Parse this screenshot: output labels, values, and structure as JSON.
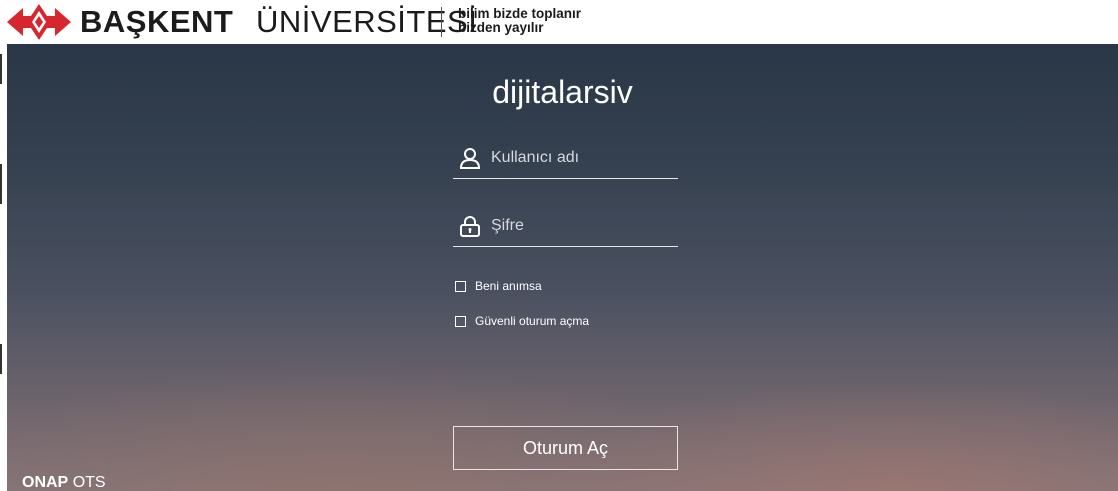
{
  "header": {
    "brand_bold": "BAŞKENT",
    "brand_thin": "ÜNİVERSİTESİ",
    "slogan_line1": "bilim bizde toplanır",
    "slogan_line2": "bizden yayılır",
    "logo_icon": "baskent-logo-icon",
    "logo_color": "#d7262e"
  },
  "login": {
    "title": "dijitalarsiv",
    "username_placeholder": "Kullanıcı adı",
    "password_placeholder": "Şifre",
    "user_icon": "user-icon",
    "lock_icon": "lock-icon",
    "remember_label": "Beni anımsa",
    "secure_label": "Güvenli oturum açma",
    "remember_checked": false,
    "secure_checked": false,
    "submit_label": "Oturum Aç"
  },
  "footer": {
    "product_bold": "ONAP",
    "product_rest": "OTS"
  }
}
